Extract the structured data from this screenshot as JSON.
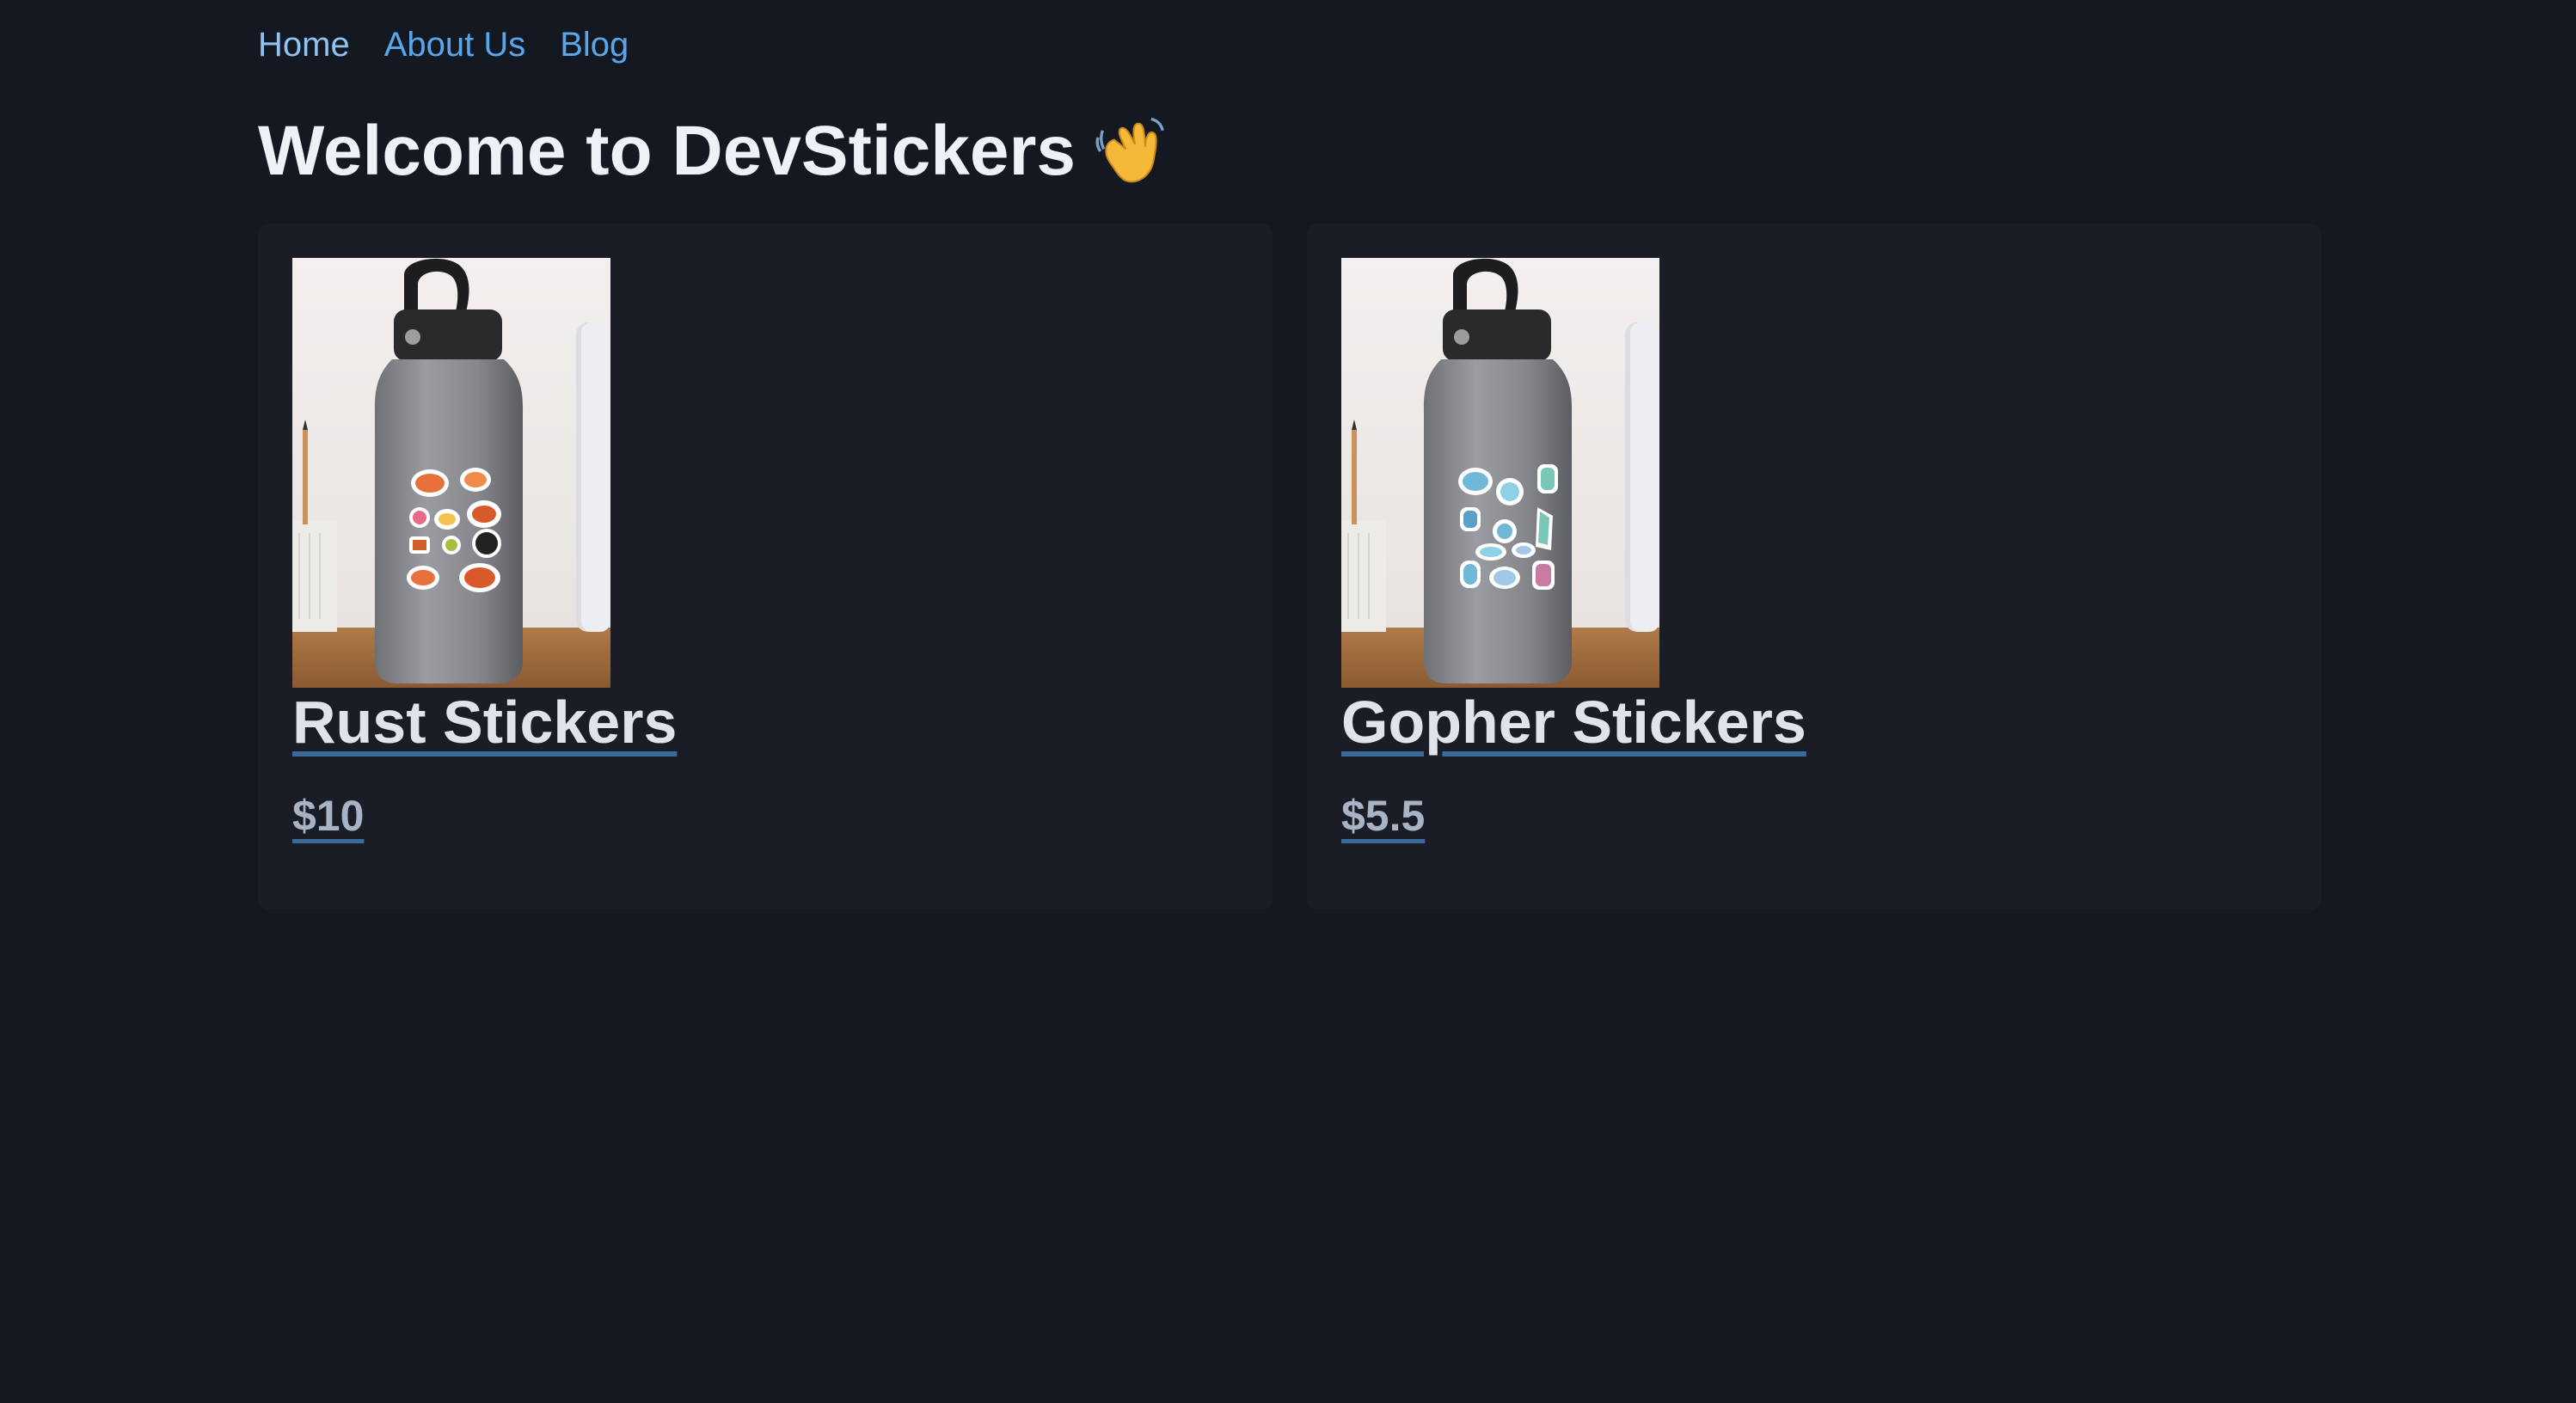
{
  "nav": {
    "items": [
      {
        "label": "Home"
      },
      {
        "label": "About Us"
      },
      {
        "label": "Blog"
      }
    ]
  },
  "page": {
    "title": "Welcome to DevStickers",
    "title_icon": "waving-hand-icon"
  },
  "products": [
    {
      "name": "Rust Stickers",
      "price": "$10",
      "image_icon": "water-bottle-with-crab-stickers",
      "sticker_colors": [
        "#e8703a",
        "#f08a4a",
        "#d85a2a",
        "#222222",
        "#f3c24a",
        "#e86a8a"
      ]
    },
    {
      "name": "Gopher Stickers",
      "price": "$5.5",
      "image_icon": "water-bottle-with-gopher-stickers",
      "sticker_colors": [
        "#6fb8d8",
        "#8fd0e6",
        "#5aa0c8",
        "#c87aa0",
        "#7ac6b8",
        "#a0c8e8"
      ]
    }
  ],
  "colors": {
    "background": "#141820",
    "card": "#1a1d26",
    "link": "#5aa6ea",
    "underline": "#3c6a9a"
  }
}
